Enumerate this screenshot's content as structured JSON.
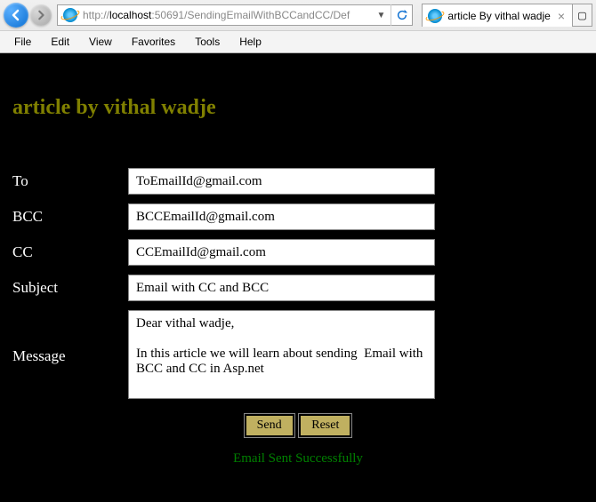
{
  "browser": {
    "url_prefix": "http://",
    "url_host": "localhost",
    "url_path": ":50691/SendingEmailWithBCCandCC/Def",
    "tab_title": "article By vithal wadje"
  },
  "menu": {
    "file": "File",
    "edit": "Edit",
    "view": "View",
    "favorites": "Favorites",
    "tools": "Tools",
    "help": "Help"
  },
  "page": {
    "heading": "article by vithal wadje"
  },
  "form": {
    "to_label": "To",
    "to_value": "ToEmailId@gmail.com",
    "bcc_label": "BCC",
    "bcc_value": "BCCEmailId@gmail.com",
    "cc_label": "CC",
    "cc_value": "CCEmailId@gmail.com",
    "subject_label": "Subject",
    "subject_value": "Email with CC and BCC",
    "message_label": "Message",
    "message_value": "Dear vithal wadje,\n\nIn this article we will learn about sending  Email with BCC and CC in Asp.net",
    "send_label": "Send",
    "reset_label": "Reset"
  },
  "status": {
    "message": "Email Sent Successfully"
  }
}
